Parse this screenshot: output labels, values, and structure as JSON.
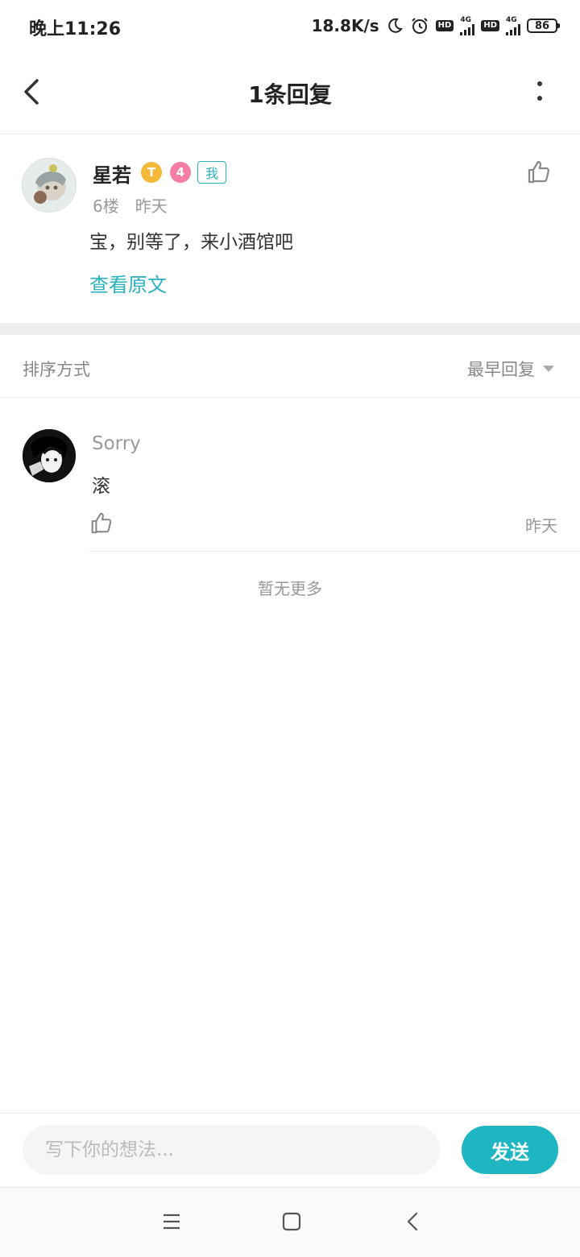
{
  "status_bar": {
    "time": "晚上11:26",
    "net_speed": "18.8K/s",
    "hd_label": "HD",
    "net_type": "4G",
    "battery": "86",
    "icons": [
      "moon-icon",
      "alarm-icon",
      "hd-icon",
      "signal-icon",
      "battery-icon"
    ]
  },
  "header": {
    "title": "1条回复",
    "back_icon": "back-chevron-icon",
    "more_icon": "more-vertical-icon"
  },
  "original_comment": {
    "username": "星若",
    "badge_t": "T",
    "badge_level": "4",
    "me_tag": "我",
    "floor": "6楼",
    "time": "昨天",
    "text": "宝，别等了，来小酒馆吧",
    "view_original": "查看原文"
  },
  "sort": {
    "label": "排序方式",
    "value": "最早回复"
  },
  "reply": {
    "username": "Sorry",
    "text": "滚",
    "time": "昨天"
  },
  "no_more": "暂无更多",
  "input": {
    "placeholder": "写下你的想法...",
    "send_label": "发送"
  },
  "colors": {
    "accent": "#1fb6c3",
    "link": "#2ab2c0",
    "muted": "#999999",
    "separator": "#efefef"
  }
}
